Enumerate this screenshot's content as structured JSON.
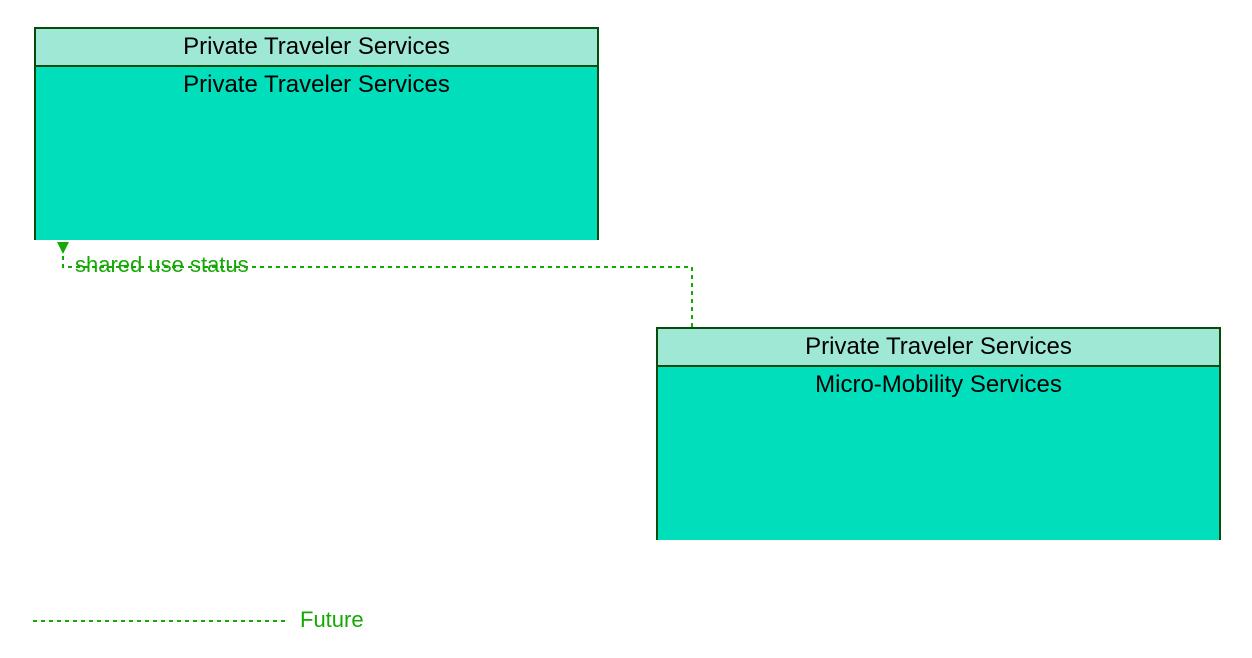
{
  "nodes": {
    "topLeft": {
      "header": "Private Traveler Services",
      "body": "Private Traveler Services",
      "headerBg": "#9fe8d5",
      "bodyBg": "#00debb"
    },
    "bottomRight": {
      "header": "Private Traveler Services",
      "body": "Micro-Mobility Services",
      "headerBg": "#9fe8d5",
      "bodyBg": "#00debb"
    }
  },
  "edge": {
    "label": "shared use status",
    "color": "#16a805"
  },
  "legend": {
    "label": "Future",
    "color": "#16a805"
  }
}
